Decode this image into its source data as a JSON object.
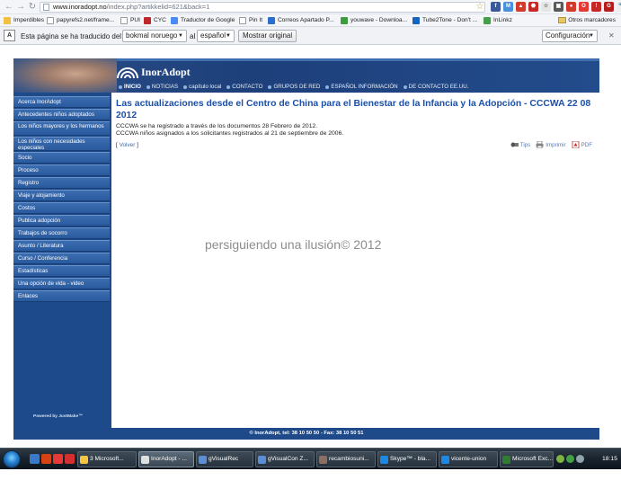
{
  "browser": {
    "url_host": "www.inoradopt.no",
    "url_path": "/index.php?artikkelid=621&back=1",
    "bookmarks": [
      "Imperdibles",
      "papyrefs2.net/frame...",
      "PUI",
      "CYC",
      "Traductor de Google",
      "Pin It",
      "Correos Apartado P...",
      "youwave - Downloa...",
      "Tube2Tone - Don't ...",
      "InLinkz"
    ],
    "bookmarks_other": "Otros marcadores"
  },
  "translate_bar": {
    "text_before": "Esta página se ha traducido del",
    "from_lang": "bokmal noruego",
    "text_mid": "al",
    "to_lang": "español",
    "show_original": "Mostrar original",
    "settings": "Configuración"
  },
  "site": {
    "logo": "InorAdopt",
    "topnav": [
      "INICIO",
      "NOTICIAS",
      "capítulo local",
      "CONTACTO",
      "GRUPOS DE RED",
      "ESPAÑOL INFORMACIÓN",
      "DE CONTACTO EE.UU."
    ],
    "sidebar": [
      "Acerca InorAdopt",
      "Antecedentes niños adoptados",
      "Los niños mayores y los hermanos",
      "Los niños con necesidades especiales",
      "Socio",
      "Proceso",
      "Registro",
      "Viaje y alojamiento",
      "Costos",
      "Publica adopción",
      "Trabajos de socorro",
      "Asunto / Literatura",
      "Curso / Conferencia",
      "Estadísticas",
      "Una opción de vida - video",
      "Enlaces"
    ],
    "powered_by": "Powered by JustMake™",
    "article": {
      "title": "Las actualizaciones desde el Centro de China para el Bienestar de la Infancia y la Adopción - CCCWA 22 08 2012",
      "line1": "CCCWA se ha registrado a través de los documentos 28 Febrero de 2012.",
      "line2": "CCCWA niños asignados a los solicitantes registrados al 21 de septiembre de 2006.",
      "back_open": "[ ",
      "back": "Volver",
      "back_close": " ]",
      "tools": [
        "Tips",
        "Imprimir",
        "PDF"
      ]
    },
    "footer": "© InorAdopt, tel: 38 10 50 50 - Fax: 38 10 50 51"
  },
  "watermark": "persiguiendo una ilusión© 2012",
  "taskbar": {
    "tasks": [
      "3 Microsoft...",
      "InorAdopt - ...",
      "gVisualRec",
      "gVisualCon Z...",
      "recambiosuni...",
      "Skype™ - bla...",
      "vicente-union",
      "Microsoft Exc..."
    ],
    "active_task": 1,
    "clock": "18:15"
  },
  "colors": {
    "brand_blue": "#1d4a8a",
    "title_blue": "#1b4fa8",
    "link_blue": "#3b6db0"
  }
}
